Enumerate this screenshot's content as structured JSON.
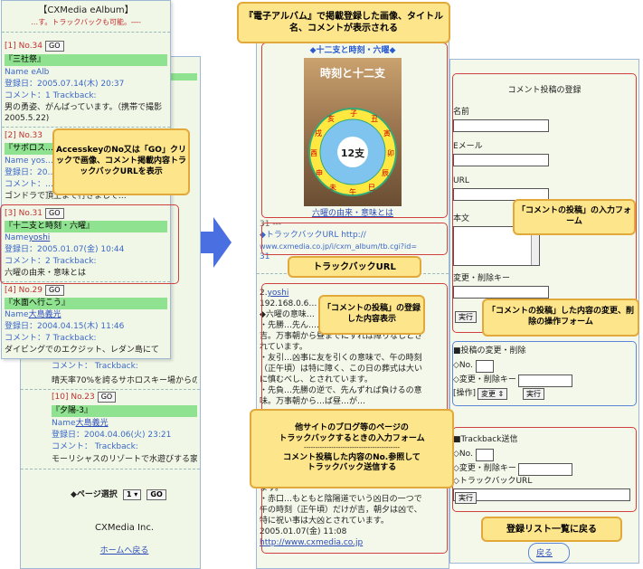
{
  "p1": {
    "title": "【CXMedia eAlbum】",
    "subtitle": "…す。トラックバックも可能。―-",
    "e1": {
      "no": "[1] No.34",
      "go": "GO",
      "title": "『三社祭』",
      "name": "Name eAlb",
      "date": "登録日：2005.07.14(木) 20:37",
      "comment": "コメント：1 Trackback:",
      "text1": "男の勇姿、がんばっています。（携帯で撮影",
      "text2": "2005.5.22)"
    },
    "e2": {
      "no": "[2] No.33",
      "title": "『サボロス…",
      "name": "Name yos…",
      "date": "登録日：20…",
      "comment": "コメント：…",
      "text": "ゴンドラで頂上まで行きまして…"
    },
    "e3": {
      "no": "[3] No.31",
      "go": "GO",
      "title": "『十二支と時刻・六曜』",
      "name_label": "Name",
      "name_value": "yoshi",
      "date": "登録日：2005.01.07(金) 10:44",
      "comment": "コメント：2 Trackback:",
      "text": "六曜の由来・意味とは"
    },
    "e4": {
      "no": "[4] No.29",
      "go": "GO",
      "title": "『水面へ行こう』",
      "name_label": "Name",
      "name_value": "大島義光",
      "date": "登録日：2004.04.15(木) 11:46",
      "comment": "コメント：7 Trackback:",
      "text": "ダイビングでのエクジット、レダン島にて"
    }
  },
  "p2": {
    "trackback": "コメント：  Trackback:",
    "text1": "晴天率70%を誇るサホロスキー場からの山々",
    "e10": {
      "no": "[10] No.23",
      "go": "GO",
      "title": "『夕陽-3』",
      "name_label": "Name",
      "name_value": "大島義光",
      "date": "登録日：2004.04.06(火) 23:21",
      "comment": "コメント：  Trackback:",
      "text": "モーリシャスのリゾートで水遊びする家族"
    },
    "page_label": "◆ページ選択",
    "page_value": "1",
    "page_go": "GO",
    "footer": "CXMedia Inc.",
    "home": "ホームへ戻る"
  },
  "p3": {
    "image_title": "◆十二支と時刻・六曜◆",
    "image_caption": "時刻と十二支",
    "clock_center": "12支",
    "image_link": "六曜の由来・意味とは",
    "id_line": "31 ---",
    "tb_line1": "◆トラックバックURL http://",
    "tb_line2": "www.cxmedia.co.jp/i/cxm_album/tb.cgi?id=",
    "tb_line3": "31",
    "c_no": "2.",
    "c_user": "yoshi",
    "c_ip": "192.168.0.6…",
    "c_title": "◆六曜の意味…",
    "lines": [
      "・先勝…先ん……………………………ば",
      "吉。万事朝から昼までにすれば障りなしとさ",
      "れています。",
      "・友引…凶事に友を引くの意味で、午の時刻",
      "（正午頃）は特に障く、この日の葬式は大い",
      "に慎むべし、とされています。",
      "・先負…先勝の逆で、先んずれば負けるの意",
      "味。万事朝から…ば昼…が…",
      "",
      "",
      "",
      "",
      "ます。",
      "・赤口…もともと陰陽道でいう凶日の一つで",
      "午の時刻（正午頃）だけが吉，朝夕は凶で、",
      "特に祝い事は大凶とされています。"
    ],
    "c_date": "2005.01.07(金) 11:08",
    "c_url": "http://www.cxmedia.co.jp"
  },
  "p4": {
    "header": "コメント投稿の登録",
    "name": "名前",
    "email": "Eメール",
    "url": "URL",
    "body": "本文",
    "delkey": "変更・削除キー",
    "submit": "実行",
    "edit_title": "■投稿の変更・削除",
    "edit_no": "◇No.",
    "edit_key": "◇変更・削除キー",
    "edit_op": "[操作]",
    "edit_select": "変更",
    "edit_btn": "実行",
    "tb_title": "■Trackback送信",
    "tb_no": "◇No.",
    "tb_key": "◇変更・削除キー",
    "tb_url": "◇トラックバックURL",
    "tb_btn": "実行",
    "back": "戻る"
  },
  "callouts": {
    "top": "『電子アルバム』で掲載登録した画像、タイトル名、コメントが表示される",
    "access": "AccesskeyのNo又は「GO」クリックで画像、コメント掲載内容トラックバックURLを表示",
    "tburl": "トラックバックURL",
    "comment_show": "「コメントの投稿」の登録した内容表示",
    "comment_form": "「コメントの投稿」の入力フォーム",
    "comment_edit": "「コメントの投稿」した内容の変更、削除の操作フォーム",
    "tb_input_1": "他サイトのブログ等のページの",
    "tb_input_2": "トラックバックするときの入力フォーム",
    "tb_input_sep": "------------------------------------------",
    "tb_input_3": "コメント投稿した内容のNo.参照して",
    "tb_input_4": "トラックバック送信する",
    "back_list": "登録リスト一覧に戻る"
  },
  "colors": {
    "accent_green": "#8fe28f",
    "callout": "#fde58c",
    "callout_border": "#e3a83a",
    "arrow": "#4a6fe0",
    "red_frame": "#d04040"
  }
}
